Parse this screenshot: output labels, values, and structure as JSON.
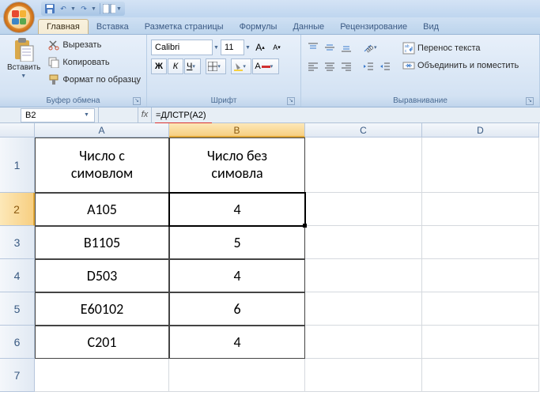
{
  "qat": {
    "save": "💾",
    "undo": "↶",
    "redo": "↷"
  },
  "tabs": {
    "home": "Главная",
    "insert": "Вставка",
    "pagelayout": "Разметка страницы",
    "formulas": "Формулы",
    "data": "Данные",
    "review": "Рецензирование",
    "view": "Вид"
  },
  "ribbon": {
    "clipboard": {
      "paste": "Вставить",
      "cut": "Вырезать",
      "copy": "Копировать",
      "format_painter": "Формат по образцу",
      "label": "Буфер обмена"
    },
    "font": {
      "name": "Calibri",
      "size": "11",
      "label": "Шрифт"
    },
    "align": {
      "wrap": "Перенос текста",
      "merge": "Объединить и поместить",
      "label": "Выравнивание"
    }
  },
  "namebox": "B2",
  "formula": "=ДЛСТР(A2)",
  "fx": "fx",
  "cols": {
    "A": "A",
    "B": "B",
    "C": "C",
    "D": "D"
  },
  "rows": [
    "1",
    "2",
    "3",
    "4",
    "5",
    "6",
    "7"
  ],
  "cells": {
    "A1a": "Число с",
    "A1b": "симовлом",
    "B1a": "Число без",
    "B1b": "симовла",
    "A2": "A105",
    "B2": "4",
    "A3": "B1105",
    "B3": "5",
    "A4": "D503",
    "B4": "4",
    "A5": "E60102",
    "B5": "6",
    "A6": "C201",
    "B6": "4"
  }
}
